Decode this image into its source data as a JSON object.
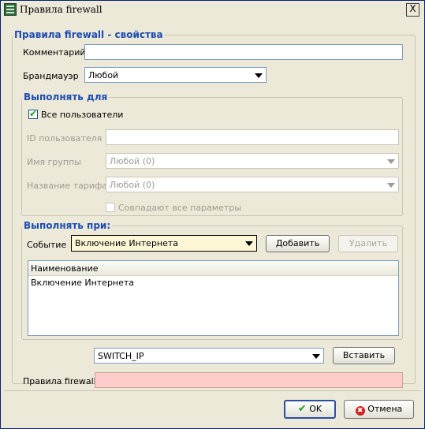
{
  "window": {
    "title": "Правила firewall",
    "close_label": "X"
  },
  "props_group": {
    "legend": "Правила firewall - свойства",
    "comment_label": "Комментарий",
    "comment_value": "",
    "firewall_label": "Брандмауэр",
    "firewall_value": "Любой"
  },
  "execute_for": {
    "legend": "Выполнять для",
    "all_users_label": "Все пользователи",
    "all_users_checked": true,
    "user_id_label": "ID пользователя",
    "group_label": "Имя группы",
    "group_value": "Любой (0)",
    "tariff_label": "Название тарифа",
    "tariff_value": "Любой (0)",
    "match_all_label": "Совпадают все параметры"
  },
  "execute_on": {
    "legend": "Выполнять при:",
    "event_label": "Событие",
    "event_value": "Включение Интернета",
    "add_label": "Добавить",
    "delete_label": "Удалить",
    "table": {
      "header": "Наименование",
      "rows": [
        "Включение Интернета"
      ]
    }
  },
  "macro": {
    "select_value": "SWITCH_IP",
    "insert_label": "Вставить"
  },
  "rules": {
    "label": "Правила firewall",
    "value": ""
  },
  "footer": {
    "ok_label": "OK",
    "cancel_label": "Отмена"
  },
  "colors": {
    "accent": "#1c4db4",
    "rules_bg": "#ffcccc",
    "ok_check": "#21a121",
    "cancel_icon": "#d32020"
  }
}
